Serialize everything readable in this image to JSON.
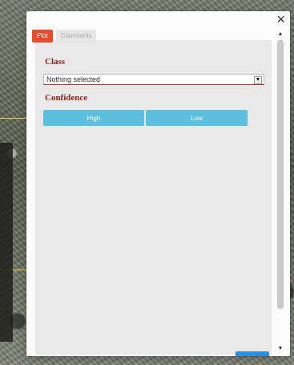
{
  "popup": {
    "close_glyph": "×",
    "tabs": [
      {
        "label": "Plot",
        "active": true
      },
      {
        "label": "Comments",
        "active": false
      }
    ],
    "class_label": "Class",
    "class_select": {
      "value": "Nothing selected"
    },
    "confidence_label": "Confidence",
    "confidence_buttons": [
      {
        "label": "High"
      },
      {
        "label": "Low"
      }
    ]
  },
  "colors": {
    "accent_tab": "#e84b2e",
    "button": "#5bc0de",
    "label": "#8d1f1f"
  },
  "icons": [
    "close-icon",
    "chevron-down-icon",
    "chevron-up-icon"
  ]
}
